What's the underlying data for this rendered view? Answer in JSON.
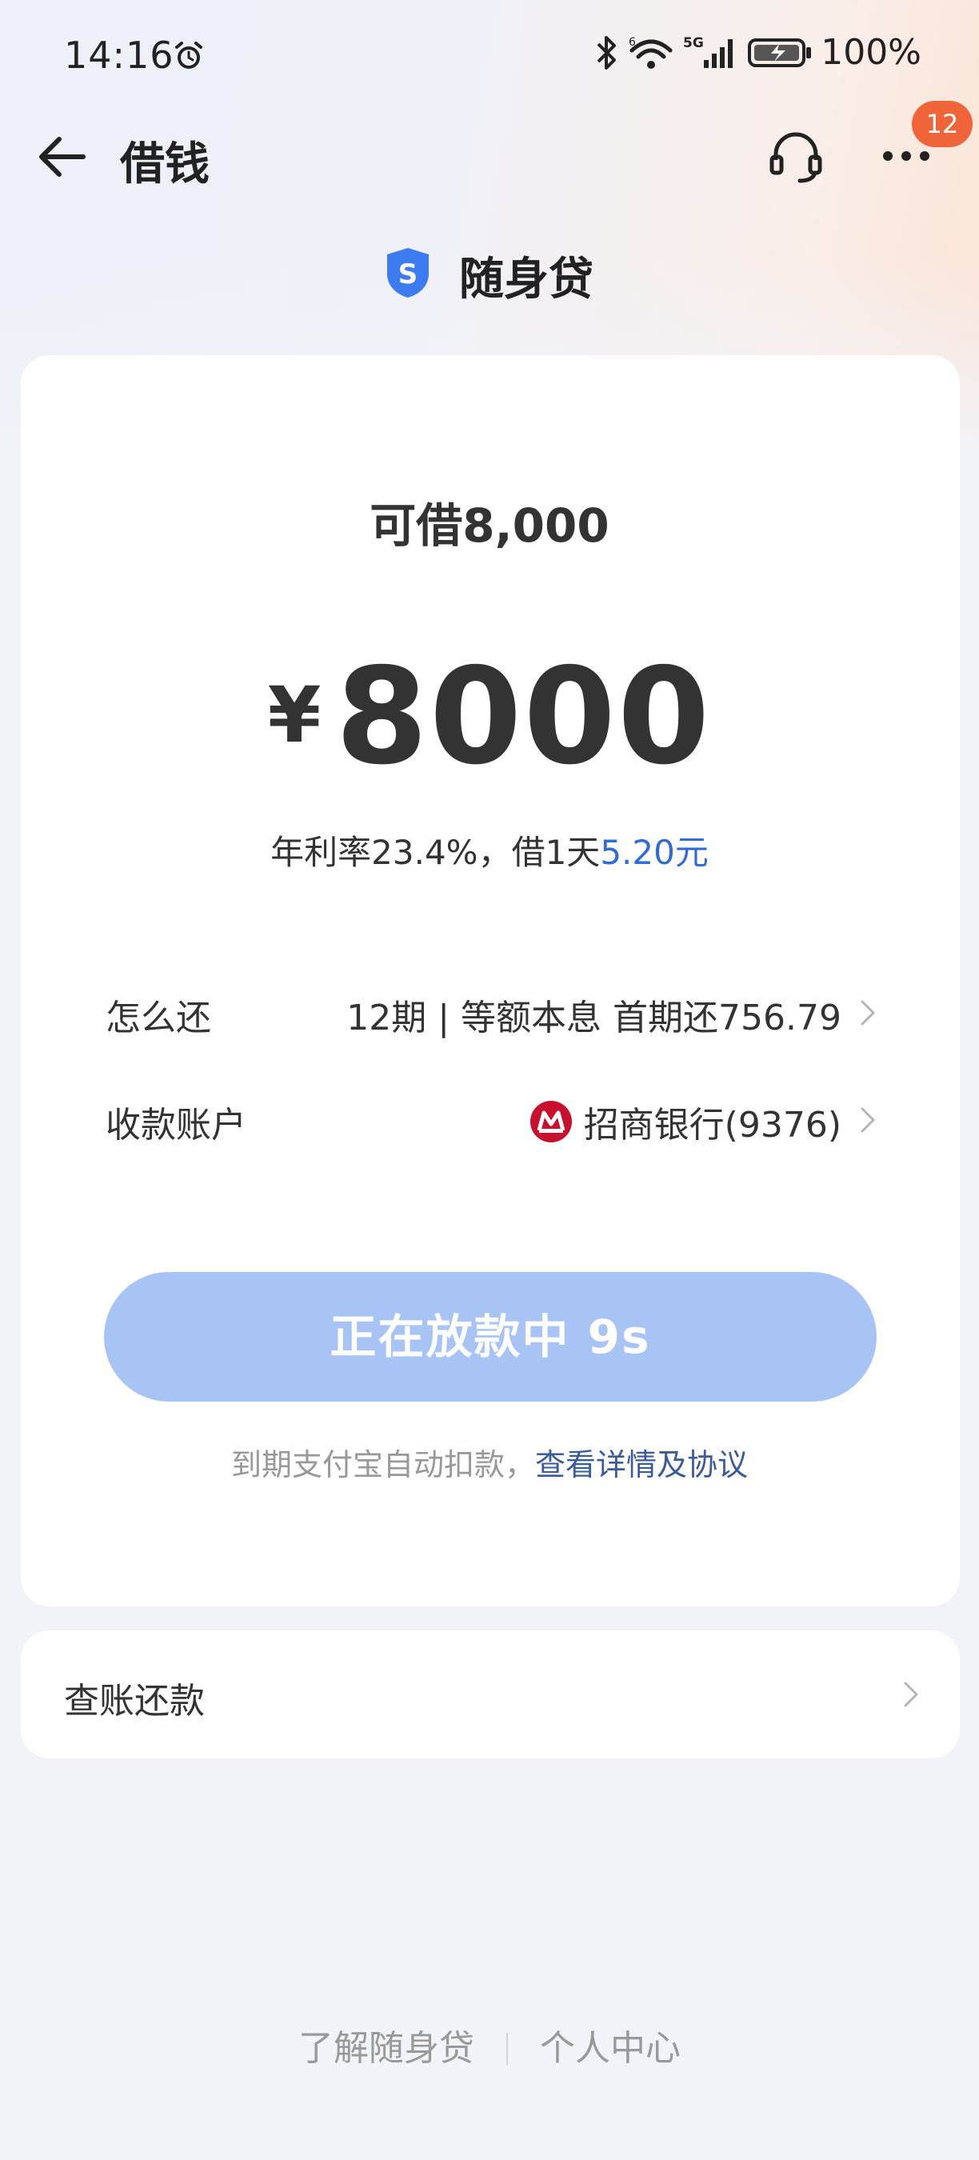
{
  "status_bar": {
    "time": "14:16",
    "battery": "100%",
    "network": "5G",
    "wifi_badge": "6"
  },
  "nav": {
    "title": "借钱",
    "badge_count": "12",
    "icons": [
      "back-arrow-icon",
      "headset-icon",
      "more-icon"
    ]
  },
  "product": {
    "name": "随身贷",
    "logo_letter": "S",
    "logo_color": "#3d7cf0"
  },
  "loan": {
    "limit_text": "可借8,000",
    "currency": "¥",
    "amount": "8000",
    "rate_prefix": "年利率23.4%，借1天",
    "rate_daily_cost": "5.20元",
    "highlight_color": "#2f6bd9"
  },
  "repayment": {
    "label": "怎么还",
    "value": "12期 | 等额本息 首期还756.79"
  },
  "account": {
    "label": "收款账户",
    "bank": "招商银行(9376)",
    "bank_logo_color": "#c8102e"
  },
  "cta": {
    "label": "正在放款中 9s",
    "color": "#a8c4f5"
  },
  "terms": {
    "prefix": "到期支付宝自动扣款，",
    "link": "查看详情及协议"
  },
  "bill": {
    "label": "查账还款"
  },
  "footer": {
    "links": [
      "了解随身贷",
      "个人中心"
    ]
  }
}
